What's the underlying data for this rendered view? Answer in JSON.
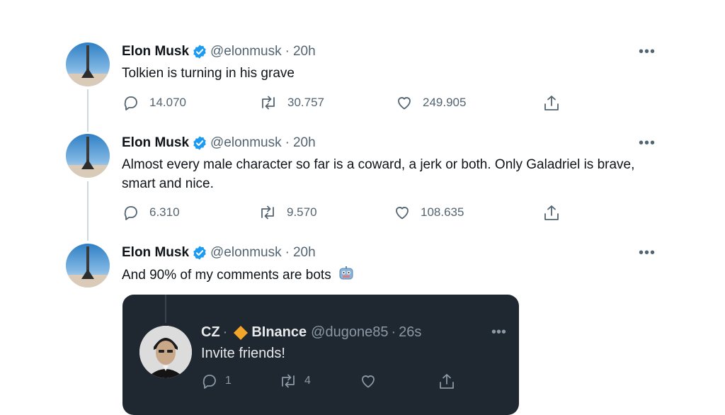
{
  "tweets": [
    {
      "name": "Elon Musk",
      "handle": "@elonmusk",
      "separator": "·",
      "time": "20h",
      "text": "Tolkien is turning in his grave",
      "replies": "14.070",
      "retweets": "30.757",
      "likes": "249.905"
    },
    {
      "name": "Elon Musk",
      "handle": "@elonmusk",
      "separator": "·",
      "time": "20h",
      "text": "Almost every male character so far is a coward, a jerk or both. Only Galadriel is brave, smart and nice.",
      "replies": "6.310",
      "retweets": "9.570",
      "likes": "108.635"
    },
    {
      "name": "Elon Musk",
      "handle": "@elonmusk",
      "separator": "·",
      "time": "20h",
      "text": "And 90% of my comments are bots",
      "emoji": "🤖"
    }
  ],
  "embedded": {
    "name_prefix": "CZ",
    "name_sep": "·",
    "name_suffix": "BInance",
    "handle": "@dugone85",
    "separator": "·",
    "time": "26s",
    "text": "Invite friends!",
    "replies": "1",
    "retweets": "4"
  },
  "icons": {
    "verified": "verified-badge-icon",
    "reply": "reply-icon",
    "retweet": "retweet-icon",
    "like": "heart-icon",
    "share": "share-icon",
    "more": "more-icon",
    "diamond": "diamond-icon",
    "robot": "robot-emoji-icon"
  },
  "colors": {
    "verified": "#1d9bf0",
    "text": "#0f1419",
    "muted": "#536471",
    "card_bg": "#1f2730",
    "diamond": "#f3a529"
  }
}
